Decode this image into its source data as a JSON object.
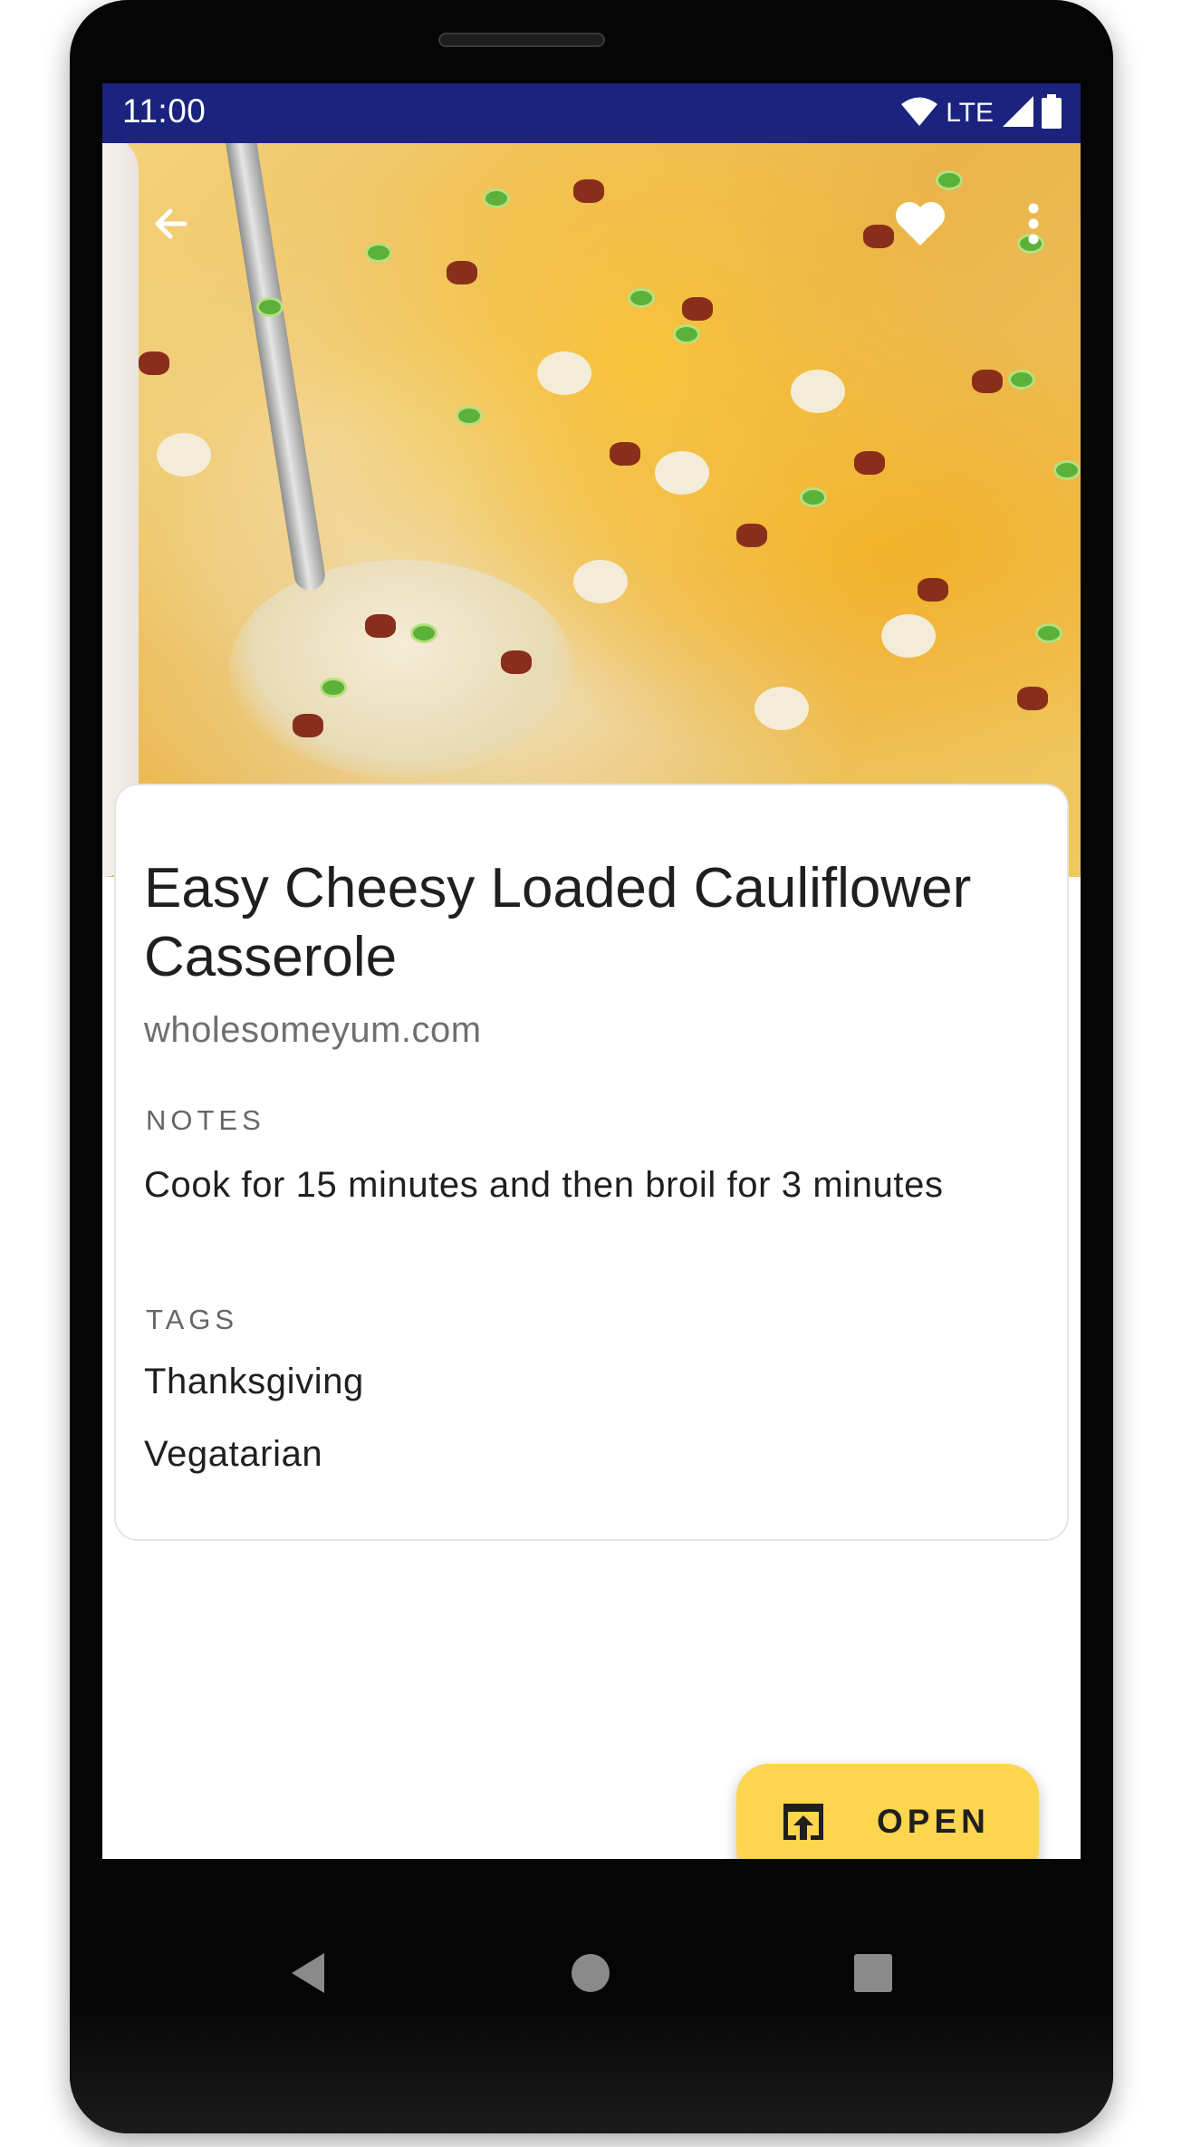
{
  "status_bar": {
    "time": "11:00",
    "network_label": "LTE",
    "icons": [
      "wifi-icon",
      "cellular-signal-icon",
      "battery-icon"
    ],
    "background_color": "#1a237e"
  },
  "app_bar": {
    "icons": [
      "back-arrow-icon",
      "favorite-heart-icon",
      "more-vertical-icon"
    ]
  },
  "recipe": {
    "title": "Easy Cheesy Loaded Cauliflower Casserole",
    "source": "wholesomeyum.com",
    "notes_label": "NOTES",
    "notes": "Cook for 15 minutes and then broil for 3 minutes",
    "tags_label": "TAGS",
    "tags": [
      "Thanksgiving",
      "Vegatarian"
    ]
  },
  "fab": {
    "label": "OPEN",
    "icon": "open-in-browser-icon",
    "color": "#fdd54f"
  },
  "nav_bar": {
    "icons": [
      "back-triangle-icon",
      "home-circle-icon",
      "recents-square-icon"
    ]
  }
}
